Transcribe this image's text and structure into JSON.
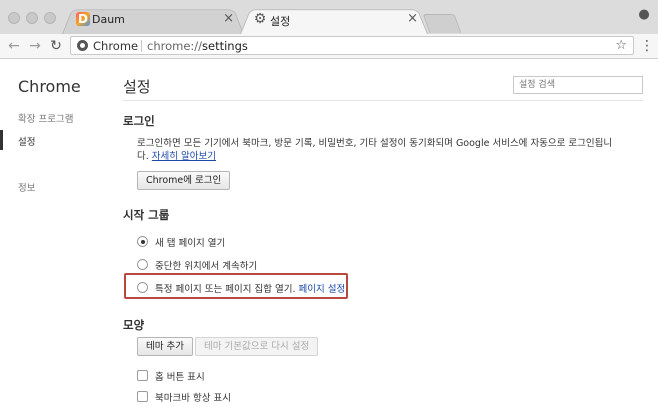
{
  "browser": {
    "tabs": [
      {
        "label": "Daum",
        "favicon": "daum-logo",
        "close": "×"
      },
      {
        "label": "설정",
        "favicon": "gear-icon",
        "close": "×"
      }
    ],
    "omnibox": {
      "site_name": "Chrome",
      "url_prefix": "chrome://",
      "url_path": "settings"
    }
  },
  "sidebar": {
    "brand": "Chrome",
    "items": [
      {
        "label": "확장 프로그램"
      },
      {
        "label": "설정"
      },
      {
        "label": "정보"
      }
    ]
  },
  "page": {
    "title": "설정",
    "search_placeholder": "설정 검색"
  },
  "signin": {
    "title": "로그인",
    "description": "로그인하면 모든 기기에서 북마크, 방문 기록, 비밀번호, 기타 설정이 동기화되며 Google 서비스에 자동으로 로그인됩니다.",
    "learn_more_link": "자세히 알아보기",
    "button": "Chrome에 로그인"
  },
  "startup": {
    "title": "시작 그룹",
    "options": [
      {
        "label": "새 탭 페이지 열기",
        "checked": true
      },
      {
        "label": "중단한 위치에서 계속하기",
        "checked": false
      },
      {
        "label": "특정 페이지 또는 페이지 집합 열기.",
        "checked": false,
        "link": "페이지 설정"
      }
    ],
    "highlight_color": "#b9493d"
  },
  "appearance": {
    "title": "모양",
    "theme_button": "테마 추가",
    "reset_button": "테마 기본값으로 다시 설정",
    "checkboxes": [
      {
        "label": "홈 버튼 표시",
        "checked": false
      },
      {
        "label": "북마크바 항상 표시",
        "checked": false
      }
    ]
  }
}
